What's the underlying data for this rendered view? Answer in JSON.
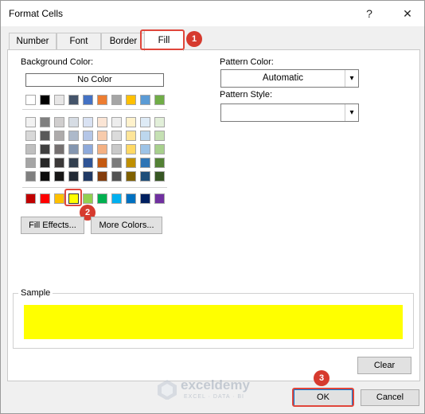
{
  "window": {
    "title": "Format Cells",
    "help_glyph": "?",
    "close_glyph": "✕"
  },
  "tabs": [
    {
      "label": "Number"
    },
    {
      "label": "Font"
    },
    {
      "label": "Border"
    },
    {
      "label": "Fill",
      "selected": true
    }
  ],
  "fill": {
    "background_color_label": "Background Color:",
    "no_color_label": "No Color",
    "pattern_color_label": "Pattern Color:",
    "pattern_color_value": "Automatic",
    "pattern_style_label": "Pattern Style:",
    "pattern_style_value": "",
    "fill_effects_label": "Fill Effects...",
    "more_colors_label": "More Colors...",
    "sample_label": "Sample",
    "sample_color": "#ffff00",
    "clear_label": "Clear",
    "selected_color": "#ffff00"
  },
  "palette": {
    "theme_top": [
      "#ffffff",
      "#000000",
      "#e7e6e6",
      "#44546a",
      "#4472c4",
      "#ed7d31",
      "#a5a5a5",
      "#ffc000",
      "#5b9bd5",
      "#70ad47"
    ],
    "theme_shades": [
      [
        "#f2f2f2",
        "#7f7f7f",
        "#d0cece",
        "#d6dce4",
        "#d9e2f3",
        "#fbe5d5",
        "#ededed",
        "#fff2cc",
        "#deebf6",
        "#e2efd9"
      ],
      [
        "#d8d8d8",
        "#595959",
        "#aeabab",
        "#adb9ca",
        "#b4c6e7",
        "#f7cbac",
        "#dbdbdb",
        "#fee599",
        "#bdd7ee",
        "#c5e0b3"
      ],
      [
        "#bfbfbf",
        "#3f3f3f",
        "#757070",
        "#8496b0",
        "#8eaadb",
        "#f4b183",
        "#c9c9c9",
        "#ffd965",
        "#9dc3e6",
        "#a8d08d"
      ],
      [
        "#a5a5a5",
        "#262626",
        "#3a3838",
        "#323f4f",
        "#2f5496",
        "#c55a11",
        "#7b7b7b",
        "#bf8f00",
        "#2e75b5",
        "#538135"
      ],
      [
        "#7f7f7f",
        "#0c0c0c",
        "#171616",
        "#222a35",
        "#1f3864",
        "#833c0b",
        "#525252",
        "#7f6000",
        "#1e4e79",
        "#375623"
      ]
    ],
    "standard": [
      "#c00000",
      "#ff0000",
      "#ffc000",
      "#ffff00",
      "#92d050",
      "#00b050",
      "#00b0f0",
      "#0070c0",
      "#002060",
      "#7030a0"
    ]
  },
  "footer": {
    "ok_label": "OK",
    "cancel_label": "Cancel"
  },
  "callouts": {
    "one": "1",
    "two": "2",
    "three": "3"
  },
  "watermark": {
    "name": "exceldemy",
    "tagline": "EXCEL · DATA · BI"
  }
}
